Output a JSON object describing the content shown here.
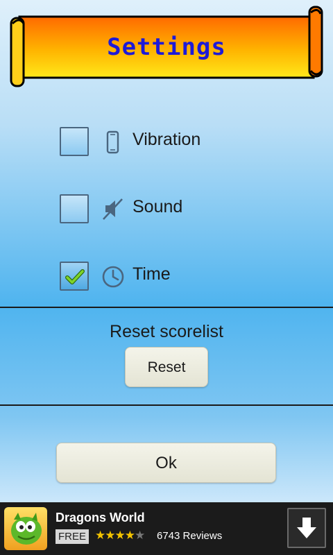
{
  "header": {
    "title": "Settings"
  },
  "settings": [
    {
      "label": "Vibration",
      "checked": false,
      "icon": "phone-icon"
    },
    {
      "label": "Sound",
      "checked": false,
      "icon": "sound-muted-icon"
    },
    {
      "label": "Time",
      "checked": true,
      "icon": "clock-icon"
    }
  ],
  "reset": {
    "heading": "Reset scorelist",
    "button_label": "Reset"
  },
  "ok": {
    "button_label": "Ok"
  },
  "ad": {
    "app_name": "Dragons World",
    "price_badge": "FREE",
    "rating": 4,
    "rating_max": 5,
    "reviews": "6743 Reviews",
    "icon": "download-icon"
  },
  "colors": {
    "title": "#1d1ad8",
    "banner_orange": "#ff6a00",
    "banner_yellow": "#ffe81a",
    "check_green": "#7fd42a",
    "star_gold": "#f4c400"
  }
}
